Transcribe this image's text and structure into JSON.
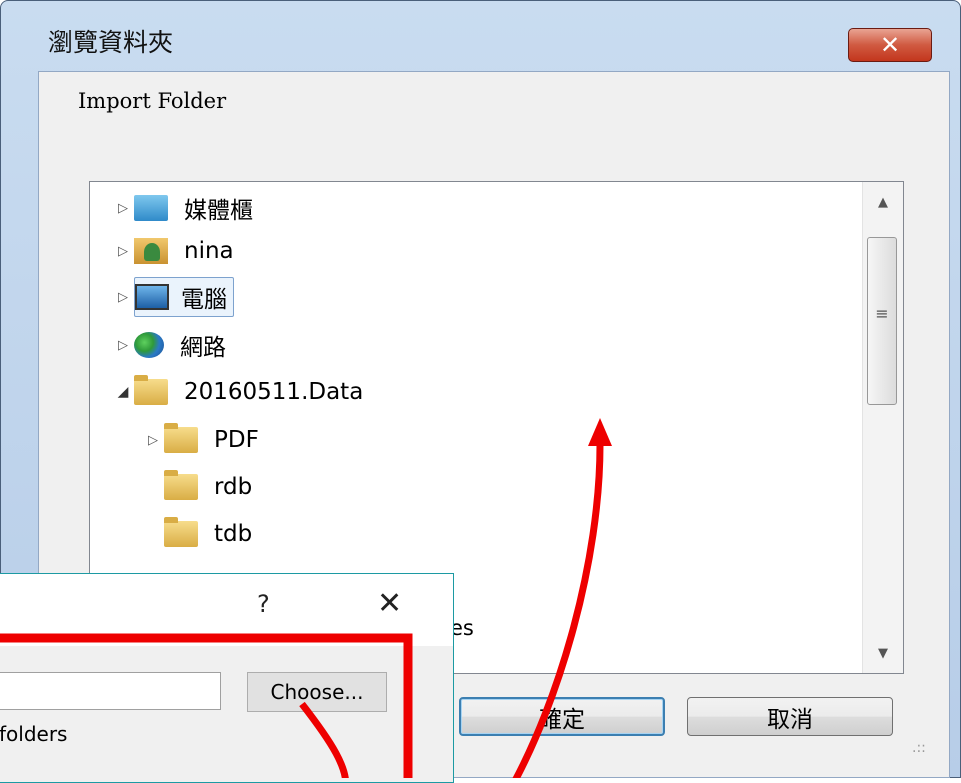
{
  "browse_dialog": {
    "title": "瀏覽資料夾",
    "close_glyph": "✕",
    "prompt": "Import Folder",
    "tree": [
      {
        "label": "媒體櫃",
        "icon": "libraries-icon",
        "expander": "▷"
      },
      {
        "label": "nina",
        "icon": "user-folder-icon",
        "expander": "▷"
      },
      {
        "label": "電腦",
        "icon": "computer-icon",
        "expander": "▷",
        "selected": true
      },
      {
        "label": "網路",
        "icon": "network-icon",
        "expander": "▷"
      },
      {
        "label": "20160511.Data",
        "icon": "folder-icon",
        "expander": "◢"
      },
      {
        "label": "PDF",
        "icon": "folder-icon",
        "expander": "▷"
      },
      {
        "label": "rdb",
        "icon": "folder-icon",
        "expander": ""
      },
      {
        "label": "tdb",
        "icon": "folder-icon",
        "expander": ""
      }
    ],
    "scroll_up": "▲",
    "scroll_down": "▼",
    "grip": "≡",
    "ok_label": "確定",
    "cancel_label": "取消",
    "resize_glyph": ".::"
  },
  "import_dialog": {
    "help_glyph": "?",
    "close_glyph": "✕",
    "choose_label": "Choose...",
    "subfolders_label": "folders",
    "spill_text": "es"
  },
  "colors": {
    "annotation": "#ee0000",
    "accent": "#3c7fb1"
  }
}
